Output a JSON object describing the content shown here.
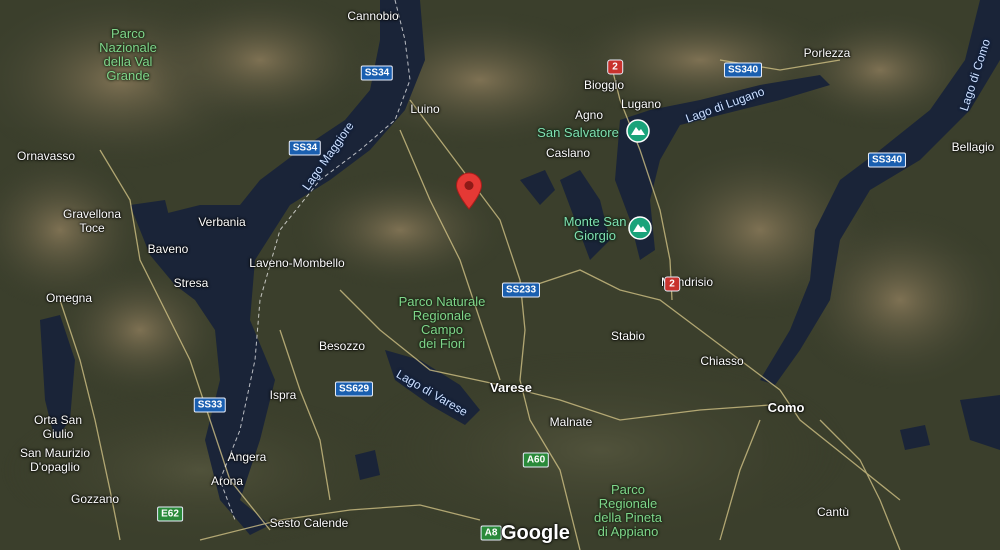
{
  "map": {
    "provider_logo": "Google",
    "labels": {
      "cannobio": "Cannobio",
      "luino": "Luino",
      "bioggio": "Bioggio",
      "lugano": "Lugano",
      "agno": "Agno",
      "porlezza": "Porlezza",
      "caslano": "Caslano",
      "bellagio": "Bellagio",
      "ornavasso": "Ornavasso",
      "verbania": "Verbania",
      "gravellona": "Gravellona\nToce",
      "baveno": "Baveno",
      "laveno": "Laveno-Mombello",
      "stresa": "Stresa",
      "omegna": "Omegna",
      "mendrisio": "Mendrisio",
      "stabio": "Stabio",
      "chiasso": "Chiasso",
      "besozzo": "Besozzo",
      "varese": "Varese",
      "ispra": "Ispra",
      "como": "Como",
      "malnate": "Malnate",
      "orta": "Orta San\nGiulio",
      "san_maurizio": "San Maurizio\nD'opaglio",
      "angera": "Angera",
      "arona": "Arona",
      "gozzano": "Gozzano",
      "sesto_calende": "Sesto Calende",
      "cantu": "Cantù"
    },
    "parks": {
      "val_grande": "Parco\nNazionale\ndella Val\nGrande",
      "campo_dei_fiori": "Parco Naturale\nRegionale\nCampo\ndei Fiori",
      "pineta": "Parco\nRegionale\ndella Pineta\ndi Appiano"
    },
    "water": {
      "lago_maggiore": "Lago Maggiore",
      "lago_lugano": "Lago di Lugano",
      "lago_como": "Lago di Como",
      "lago_varese": "Lago di Varese"
    },
    "pois": {
      "san_salvatore": "San Salvatore",
      "monte_san_giorgio": "Monte San\nGiorgio"
    },
    "roads": {
      "ss34_a": "SS34",
      "ss34_b": "SS34",
      "ss340_a": "SS340",
      "ss340_b": "SS340",
      "r2_a": "2",
      "r2_b": "2",
      "ss233": "SS233",
      "ss629": "SS629",
      "ss33": "SS33",
      "a60": "A60",
      "e62": "E62",
      "a8": "A8"
    },
    "icons": {
      "pin": "map-pin-icon",
      "mountain": "mountain-icon"
    },
    "colors": {
      "pin": "#e53935",
      "poi": "#1aa37a",
      "road_shield": "#1a5fb0",
      "motorway_shield": "#2a8a3a"
    }
  }
}
